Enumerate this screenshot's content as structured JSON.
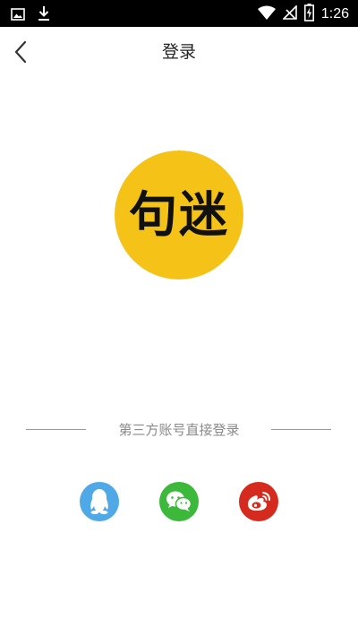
{
  "status_bar": {
    "time": "1:26",
    "icons": [
      "gallery-icon",
      "download-icon",
      "wifi-icon",
      "no-signal-icon",
      "battery-charging-icon"
    ]
  },
  "header": {
    "title": "登录",
    "back_icon": "chevron-left-icon"
  },
  "logo": {
    "text": "句迷",
    "background": "#f5c318"
  },
  "third_party": {
    "label": "第三方账号直接登录",
    "providers": [
      {
        "name": "qq",
        "icon": "qq-penguin-icon",
        "color": "#4ea9e6"
      },
      {
        "name": "wechat",
        "icon": "wechat-icon",
        "color": "#3cb83a"
      },
      {
        "name": "weibo",
        "icon": "weibo-icon",
        "color": "#d52b1e"
      }
    ]
  }
}
